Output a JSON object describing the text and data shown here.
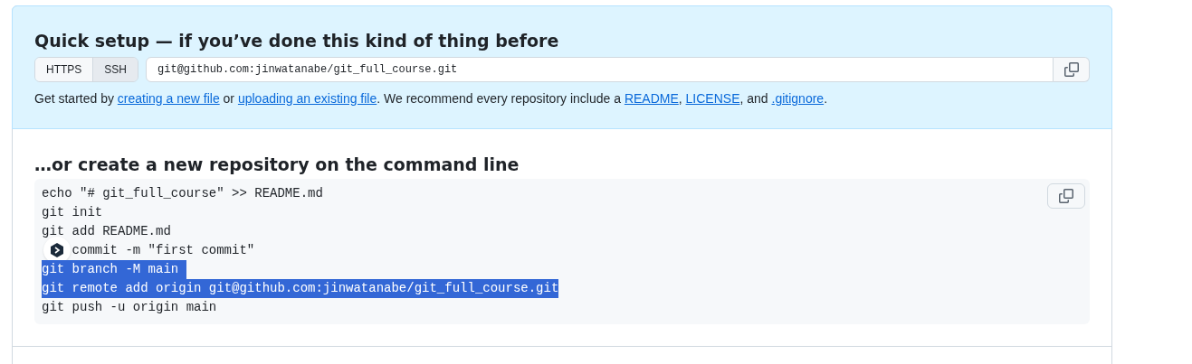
{
  "quick_setup": {
    "title": "Quick setup — if you’ve done this kind of thing before",
    "protocols": [
      {
        "label": "HTTPS",
        "selected": false
      },
      {
        "label": "SSH",
        "selected": true
      }
    ],
    "url": "git@github.com:jinwatanabe/git_full_course.git",
    "help": [
      {
        "kind": "text",
        "text": "Get started by "
      },
      {
        "kind": "link",
        "text": "creating a new file"
      },
      {
        "kind": "text",
        "text": " or "
      },
      {
        "kind": "link",
        "text": "uploading an existing file"
      },
      {
        "kind": "text",
        "text": ". We recommend every repository include a "
      },
      {
        "kind": "link",
        "text": "README"
      },
      {
        "kind": "text",
        "text": ", "
      },
      {
        "kind": "link",
        "text": "LICENSE"
      },
      {
        "kind": "text",
        "text": ", and "
      },
      {
        "kind": "link",
        "text": ".gitignore"
      },
      {
        "kind": "text",
        "text": "."
      }
    ]
  },
  "command_line": {
    "title": "…or create a new repository on the command line",
    "lines": [
      {
        "text": "echo \"# git_full_course\" >> README.md",
        "selected": false,
        "covered": false
      },
      {
        "text": "git init",
        "selected": false,
        "covered": false
      },
      {
        "text": "git add README.md",
        "selected": false,
        "covered": false
      },
      {
        "text": "commit -m \"first commit\"",
        "selected": false,
        "covered": true
      },
      {
        "text": "git branch -M main ",
        "selected": true,
        "covered": false
      },
      {
        "text": "git remote add origin git@github.com:jinwatanabe/git_full_course.git",
        "selected": true,
        "covered": false
      },
      {
        "text": "git push -u origin main",
        "selected": false,
        "covered": false
      }
    ]
  }
}
